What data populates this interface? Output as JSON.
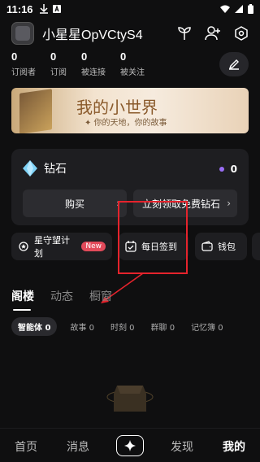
{
  "status_bar": {
    "time": "11:16",
    "icons": [
      "download-icon",
      "notification-a-icon",
      "wifi-icon",
      "signal-icon",
      "battery-icon"
    ]
  },
  "profile": {
    "username": "小星星OpVCtyS4",
    "actions": [
      "sprout-icon",
      "add-user-icon",
      "settings-hex-icon"
    ]
  },
  "stats": [
    {
      "value": "0",
      "label": "订阅者"
    },
    {
      "value": "0",
      "label": "订阅"
    },
    {
      "value": "0",
      "label": "被连接"
    },
    {
      "value": "0",
      "label": "被关注"
    }
  ],
  "banner": {
    "title": "我的小世界",
    "subtitle": "✦ 你的天地，你的故事"
  },
  "diamond": {
    "label": "钻石",
    "balance": "0",
    "buy_label": "购买",
    "free_label": "立刻领取免费钻石",
    "chevron": "›"
  },
  "chips": [
    {
      "label": "星守望计划",
      "badge": "New",
      "icon": "star-planet-icon"
    },
    {
      "label": "每日签到",
      "icon": "calendar-check-icon"
    },
    {
      "label": "钱包",
      "icon": "wallet-icon"
    }
  ],
  "tabs": [
    {
      "label": "阁楼",
      "active": true
    },
    {
      "label": "动态",
      "active": false
    },
    {
      "label": "橱窗",
      "active": false
    }
  ],
  "filters": [
    {
      "label": "智能体 0",
      "active": true
    },
    {
      "label": "故事 0",
      "active": false
    },
    {
      "label": "时刻 0",
      "active": false
    },
    {
      "label": "群聊 0",
      "active": false
    },
    {
      "label": "记忆簿 0",
      "active": false
    }
  ],
  "bottom_nav": [
    {
      "label": "首页",
      "active": false
    },
    {
      "label": "消息",
      "active": false
    },
    {
      "label": "发现",
      "active": false
    },
    {
      "label": "我的",
      "active": true
    }
  ],
  "colors": {
    "background": "#0f0f10",
    "card": "#1e1e21",
    "highlight": "#e5232c",
    "new_badge": "#e24a5a",
    "diamond_dot": "#9a6df5"
  }
}
